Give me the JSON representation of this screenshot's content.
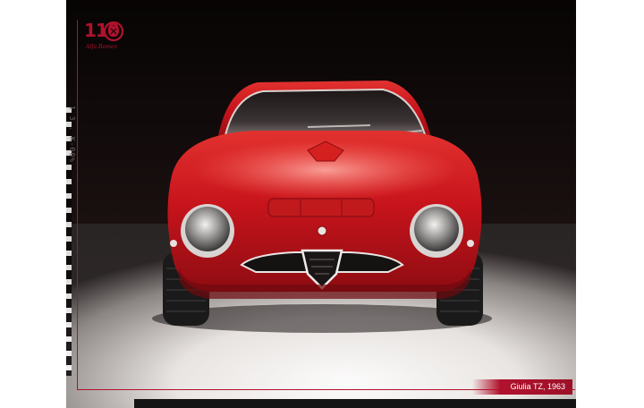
{
  "logo": {
    "number": "110",
    "brand_script": "Alfa Romeo"
  },
  "film_code": "1 3 . K-00%",
  "caption": "Giulia TZ, 1963",
  "colors": {
    "accent": "#b0122c",
    "car_red": "#c8141c",
    "backdrop": "#0b0707",
    "floor": "#f4f2ef"
  }
}
